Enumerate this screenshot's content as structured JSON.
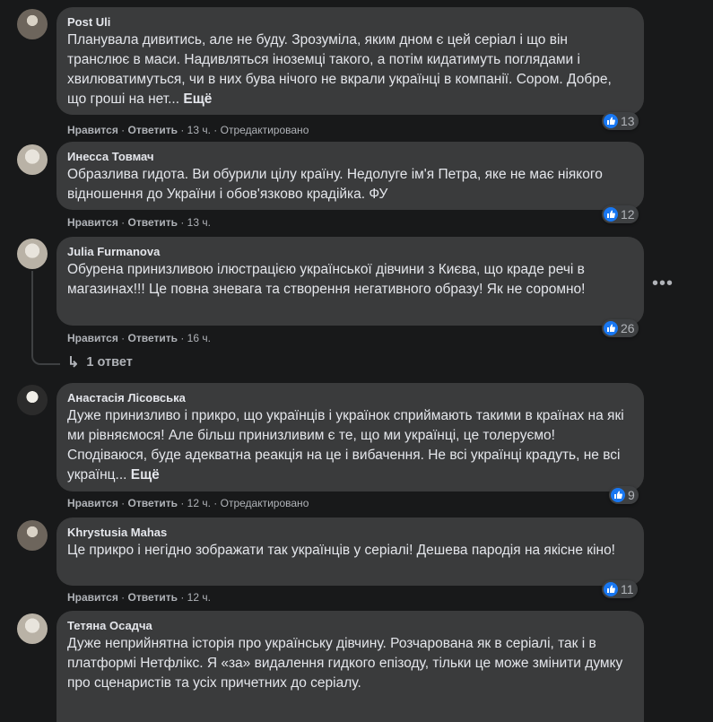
{
  "labels": {
    "like": "Нравится",
    "reply": "Ответить",
    "sep": "·",
    "more": "Ещё"
  },
  "comments": [
    {
      "author": "Post Uli",
      "text": "Планувала дивитись, але не буду. Зрозуміла, яким дном є цей серіал і що він транслює в маси. Надивляться іноземці такого, а потім кидатимуть поглядами і хвилюватимуться, чи в них бува нічого не вкрали українці в компанії. Сором. Добре, що гроші на нет...",
      "time": "13 ч.",
      "edited": "Отредактировано",
      "reactions": "13"
    },
    {
      "author": "Инесса Товмач",
      "text": "Образлива гидота. Ви обурили цілу країну. Недолуге ім'я Петра, яке не має ніякого відношення до України і обов'язково крадійка. ФУ",
      "time": "13 ч.",
      "reactions": "12"
    },
    {
      "author": "Julia Furmanova",
      "text": "Обурена принизливою ілюстрацією української дівчини з Києва, що краде речі в магазинах!!! Це повна зневага та створення негативного образу! Як не соромно!",
      "time": "16 ч.",
      "reactions": "26",
      "replies": "1 ответ"
    },
    {
      "author": "Анастасія Лісовська",
      "text": "Дуже принизливо і прикро, що українців і українок сприймають такими в країнах на які ми рівняємося! Але більш принизливим є те, що ми українці, це толеруємо! Сподіваюся, буде адекватна реакція на це і вибачення. Не всі українці крадуть, не всі українц...",
      "time": "12 ч.",
      "edited": "Отредактировано",
      "reactions": "9"
    },
    {
      "author": "Khrystusia Mahas",
      "text": "Це прикро і негідно зображати так українців у серіалі! Дешева пародія на якісне кіно!",
      "time": "12 ч.",
      "reactions": "11"
    },
    {
      "author": "Тетяна Осадча",
      "text": "Дуже неприйнятна історія про українську дівчину. Розчарована як в серіалі, так і в платформі Нетфлікс. Я «за» видалення гидкого епізоду, тільки це може змінити думку про сценаристів та усіх причетних до серіалу."
    }
  ]
}
